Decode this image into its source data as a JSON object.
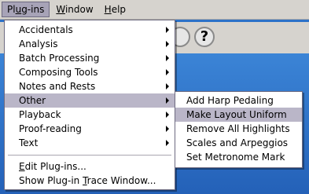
{
  "menubar": {
    "items": [
      {
        "pre": "Pl",
        "mn": "u",
        "post": "g-ins",
        "active": true
      },
      {
        "pre": "",
        "mn": "W",
        "post": "indow",
        "active": false
      },
      {
        "pre": "",
        "mn": "H",
        "post": "elp",
        "active": false
      }
    ]
  },
  "toolbar": {
    "help_icon_glyph": "?"
  },
  "plugins_menu": {
    "items": [
      {
        "label": "Accidentals",
        "submenu": true
      },
      {
        "label": "Analysis",
        "submenu": true
      },
      {
        "label": "Batch Processing",
        "submenu": true
      },
      {
        "label": "Composing Tools",
        "submenu": true
      },
      {
        "label": "Notes and Rests",
        "submenu": true
      },
      {
        "label": "Other",
        "submenu": true,
        "highlighted": true
      },
      {
        "label": "Playback",
        "submenu": true
      },
      {
        "label": "Proof-reading",
        "submenu": true
      },
      {
        "label": "Text",
        "submenu": true
      }
    ],
    "commands": [
      {
        "pre": "",
        "mn": "E",
        "post": "dit Plug-ins..."
      },
      {
        "pre": "Show Plug-in ",
        "mn": "T",
        "post": "race Window..."
      }
    ]
  },
  "other_submenu": {
    "items": [
      {
        "label": "Add Harp Pedaling"
      },
      {
        "label": "Make Layout Uniform",
        "highlighted": true
      },
      {
        "label": "Remove All Highlights"
      },
      {
        "label": "Scales and Arpeggios"
      },
      {
        "label": "Set Metronome Mark"
      }
    ]
  }
}
